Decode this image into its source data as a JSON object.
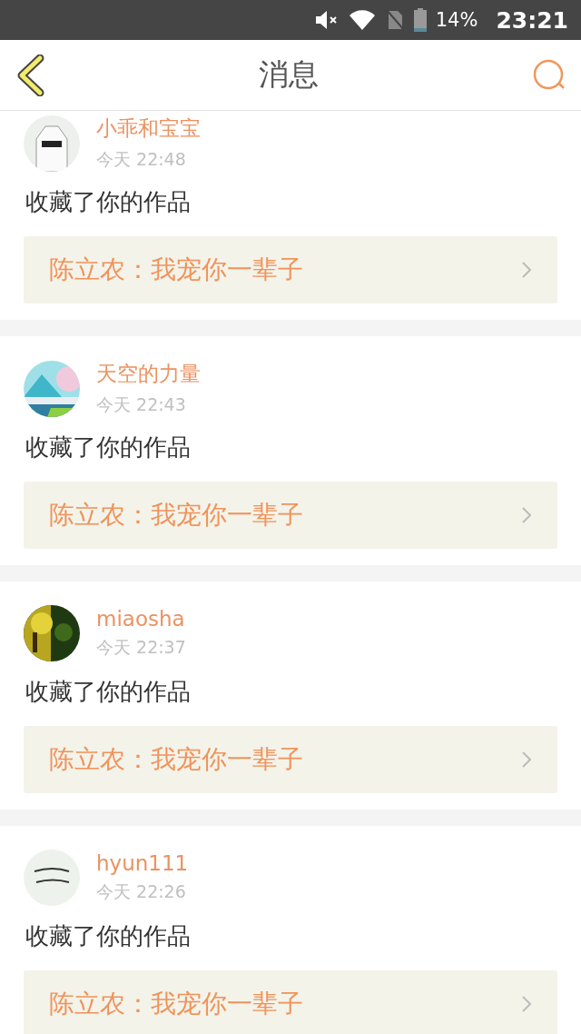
{
  "status_bar": {
    "battery": "14%",
    "time": "23:21"
  },
  "header": {
    "title": "消息"
  },
  "messages": [
    {
      "user": "小乖和宝宝",
      "time": "今天 22:48",
      "action": "收藏了你的作品",
      "work": "陈立农：我宠你一辈子"
    },
    {
      "user": "天空的力量",
      "time": "今天 22:43",
      "action": "收藏了你的作品",
      "work": "陈立农：我宠你一辈子"
    },
    {
      "user": "miaosha",
      "time": "今天 22:37",
      "action": "收藏了你的作品",
      "work": "陈立农：我宠你一辈子"
    },
    {
      "user": "hyun111",
      "time": "今天 22:26",
      "action": "收藏了你的作品",
      "work": "陈立农：我宠你一辈子"
    }
  ]
}
